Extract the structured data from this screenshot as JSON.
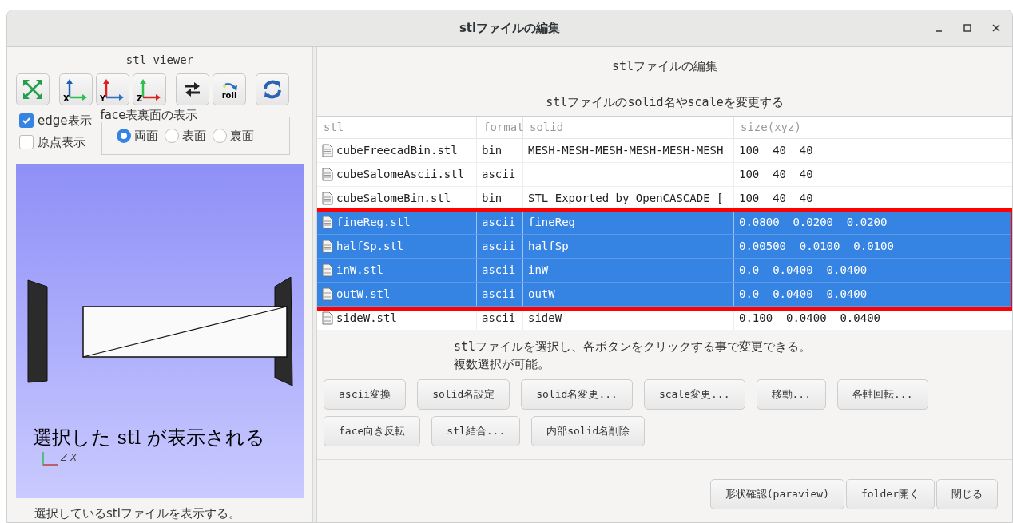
{
  "window": {
    "title": "stlファイルの編集"
  },
  "viewer": {
    "title": "stl viewer",
    "toolbar": [
      {
        "kind": "fit"
      },
      {
        "kind": "axis",
        "label": "X"
      },
      {
        "kind": "axis",
        "label": "Y"
      },
      {
        "kind": "axis",
        "label": "Z"
      },
      {
        "kind": "swap"
      },
      {
        "kind": "roll",
        "label": "roll"
      },
      {
        "kind": "refresh"
      }
    ],
    "checkboxes": [
      {
        "label": "edge表示",
        "checked": true
      },
      {
        "label": "原点表示",
        "checked": false
      }
    ],
    "face_group": {
      "title": "face表裏面の表示",
      "options": [
        {
          "label": "両面",
          "selected": true
        },
        {
          "label": "表面",
          "selected": false
        },
        {
          "label": "裏面",
          "selected": false
        }
      ]
    },
    "viewport": {
      "annotation": "選択した stl が表示される",
      "axis_labels": [
        "Z",
        "X"
      ]
    },
    "caption": "選択しているstlファイルを表示する。"
  },
  "editor": {
    "title": "stlファイルの編集",
    "subtitle": "stlファイルのsolid名やscaleを変更する",
    "table": {
      "columns": [
        "stl",
        "format",
        "solid",
        "size(xyz)"
      ],
      "rows": [
        {
          "stl": "cubeFreecadBin.stl",
          "format": "bin",
          "solid": "MESH-MESH-MESH-MESH-MESH-MESH",
          "size": "100  40  40",
          "selected": false
        },
        {
          "stl": "cubeSalomeAscii.stl",
          "format": "ascii",
          "solid": "",
          "size": "100  40  40",
          "selected": false
        },
        {
          "stl": "cubeSalomeBin.stl",
          "format": "bin",
          "solid": "STL Exported by OpenCASCADE [",
          "size": "100  40  40",
          "selected": false
        },
        {
          "stl": "fineReg.stl",
          "format": "ascii",
          "solid": "fineReg",
          "size": "0.0800  0.0200  0.0200",
          "selected": true
        },
        {
          "stl": "halfSp.stl",
          "format": "ascii",
          "solid": "halfSp",
          "size": "0.00500  0.0100  0.0100",
          "selected": true
        },
        {
          "stl": "inW.stl",
          "format": "ascii",
          "solid": "inW",
          "size": "0.0  0.0400  0.0400",
          "selected": true
        },
        {
          "stl": "outW.stl",
          "format": "ascii",
          "solid": "outW",
          "size": "0.0  0.0400  0.0400",
          "selected": true
        },
        {
          "stl": "sideW.stl",
          "format": "ascii",
          "solid": "sideW",
          "size": "0.100  0.0400  0.0400",
          "selected": false
        }
      ]
    },
    "message": [
      "stlファイルを選択し、各ボタンをクリックする事で変更できる。",
      "複数選択が可能。"
    ],
    "button_rows": [
      [
        "ascii変換",
        "solid名設定",
        "solid名変更...",
        "scale変更...",
        "移動...",
        "各軸回転..."
      ],
      [
        "face向き反転",
        "stl結合...",
        "内部solid名削除"
      ]
    ],
    "footer_buttons": [
      "形状確認(paraview)",
      "folder開く",
      "閉じる"
    ]
  }
}
